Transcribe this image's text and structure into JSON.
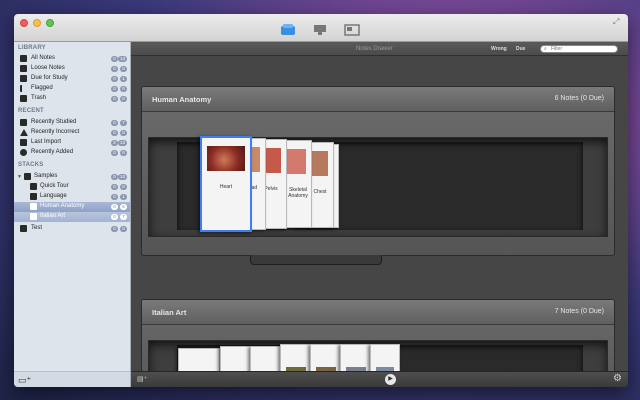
{
  "sidebar": {
    "sections": [
      {
        "title": "LIBRARY"
      },
      {
        "title": "RECENT"
      },
      {
        "title": "STACKS"
      }
    ],
    "library": [
      {
        "label": "All Notes",
        "b1": "0",
        "b2": "13"
      },
      {
        "label": "Loose Notes",
        "b1": "0",
        "b2": "0"
      },
      {
        "label": "Due for Study",
        "b1": "0",
        "b2": "1"
      },
      {
        "label": "Flagged",
        "b1": "0",
        "b2": "0"
      },
      {
        "label": "Trash",
        "b1": "0",
        "b2": "0"
      }
    ],
    "recent": [
      {
        "label": "Recently Studied",
        "b1": "0",
        "b2": "7"
      },
      {
        "label": "Recently Incorrect",
        "b1": "0",
        "b2": "0"
      },
      {
        "label": "Last Import",
        "b1": "2",
        "b2": "13"
      },
      {
        "label": "Recently Added",
        "b1": "0",
        "b2": "0"
      }
    ],
    "stacks": [
      {
        "label": "Samples",
        "b1": "0",
        "b2": "13"
      },
      {
        "label": "Quick Tour",
        "b1": "0",
        "b2": "0"
      },
      {
        "label": "Language",
        "b1": "0",
        "b2": "1"
      },
      {
        "label": "Human Anatomy",
        "b1": "0",
        "b2": "6"
      },
      {
        "label": "Italian Art",
        "b1": "0",
        "b2": "7"
      },
      {
        "label": "Test",
        "b1": "0",
        "b2": "0"
      }
    ]
  },
  "header": {
    "title": "Notes Drawer",
    "wrong_label": "Wrong",
    "due_label": "Due",
    "filter_placeholder": "Filter"
  },
  "drawers": [
    {
      "name": "Human Anatomy",
      "count": "6 Notes (0 Due)",
      "cards": [
        {
          "label": "Heart",
          "color": "#b0463a"
        },
        {
          "label": "ead",
          "color": "#c98a66"
        },
        {
          "label": "Pelvis",
          "color": "#c55a4a"
        },
        {
          "label": "Skeletal Anatomy",
          "color": "#d37a6d"
        },
        {
          "label": "Chest",
          "color": "#b7795e"
        },
        {
          "label": "",
          "color": "#8a5a58"
        }
      ]
    },
    {
      "name": "Italian Art",
      "count": "7 Notes (0 Due)",
      "cards": [
        {
          "label": "",
          "color": "#555"
        },
        {
          "label": "",
          "color": "#4d5a6e"
        },
        {
          "label": "",
          "color": "#6b5a4a"
        },
        {
          "label": "",
          "color": "#6b6b3e"
        },
        {
          "label": "",
          "color": "#7a6542"
        },
        {
          "label": "",
          "color": "#7a7e8a"
        },
        {
          "label": "",
          "color": "#7d8aa0"
        }
      ]
    }
  ],
  "colors": {
    "selection_blue": "#3b7ff5",
    "sidebar_bg": "#dde4ec"
  }
}
